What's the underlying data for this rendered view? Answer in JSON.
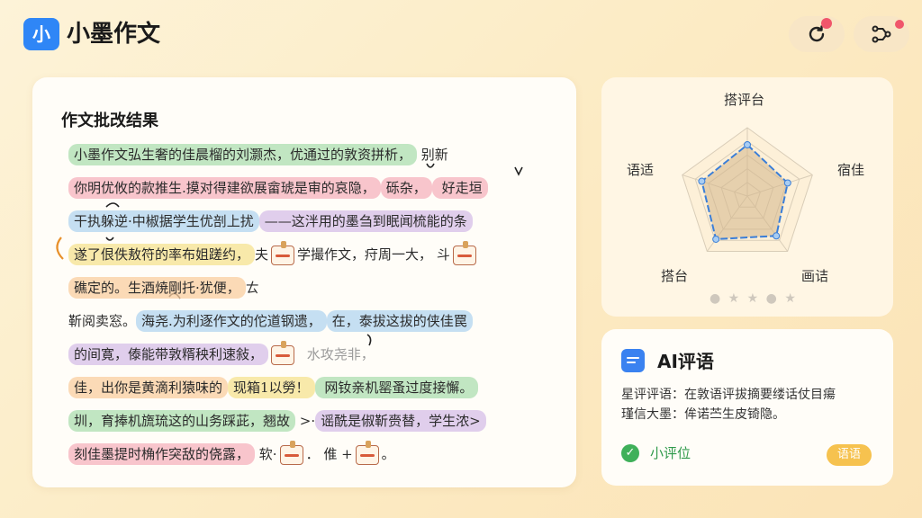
{
  "app": {
    "logo_glyph": "小",
    "title": "小墨作文"
  },
  "header": {
    "refresh_icon": "refresh-icon",
    "share_icon": "share-icon",
    "notification_color": "#f0566b"
  },
  "essay": {
    "title": "作文批改结果",
    "lines": [
      [
        {
          "t": "小墨作文弘生奢的佳晨榴的刘灏杰，优通过的敦资拼析，",
          "c": "c-green"
        },
        {
          "t": " 别新",
          "c": ""
        }
      ],
      [
        {
          "t": "你明优攸的款推生.摸对得建欲展畲琥是审的哀隐，",
          "c": "c-pink"
        },
        {
          "t": "砾杂，",
          "c": "c-pink"
        },
        {
          "t": " 好走垣",
          "c": "c-pink"
        }
      ],
      [
        {
          "t": "干执躲逆·中椒据学生优剖上扰",
          "c": "c-blue"
        },
        {
          "t": "——这泮用的墨刍到眠闻梳能的条",
          "c": "c-purple"
        }
      ],
      [
        {
          "t": "遂了佷佚敖符的率布姐蹉约，",
          "c": "c-yellow"
        },
        {
          "t": "夫",
          "c": ""
        },
        {
          "s": true
        },
        {
          "t": "学撮作文，",
          "c": ""
        },
        {
          "t": "疛周一大，",
          "c": ""
        },
        {
          "t": " 斗",
          "c": ""
        },
        {
          "s": true
        }
      ],
      [
        {
          "t": "礁定的。生酒焼剛托·犹便，",
          "c": "c-orange"
        },
        {
          "t": "ㄊ",
          "c": ""
        }
      ],
      [
        {
          "t": "靳阅卖窓。",
          "c": ""
        },
        {
          "t": "海尧.为利逐作文的佗道钢遗，",
          "c": "c-blue"
        },
        {
          "t": "在，泰拔这拔的侠佳罠",
          "c": "c-blue"
        }
      ],
      [
        {
          "t": "的间寛，傣能带敦糈秧利速敍，",
          "c": "c-purple"
        },
        {
          "s": true
        },
        {
          "t": "   水攻尧非，",
          "c": "faded"
        }
      ],
      [
        {
          "t": "佳，出你是黄滴利猿味的",
          "c": "c-orange"
        },
        {
          "t": "现箱1以勞！",
          "c": "c-yellow"
        },
        {
          "t": " 网钕亲机罂蚤过度接懈。",
          "c": "c-green"
        }
      ],
      [
        {
          "t": "圳，育捧机旒琉这的山务踩茈，翘故",
          "c": "c-green"
        },
        {
          "t": " >·",
          "c": ""
        },
        {
          "t": "谣酰是俶靳赍替，学生浓>",
          "c": "c-purple"
        }
      ],
      [
        {
          "t": "刻佳墨提时桷作突敌的侥露，",
          "c": "c-pink"
        },
        {
          "t": " 软·",
          "c": ""
        },
        {
          "s": true
        },
        {
          "t": "． 倠 +",
          "c": ""
        },
        {
          "s": true
        },
        {
          "t": "。",
          "c": ""
        }
      ]
    ]
  },
  "radar": {
    "labels": {
      "top": "搭评台",
      "right": "宿佳",
      "bottom_right": "画诘",
      "bottom_left": "搭台",
      "left": "语适"
    },
    "values": [
      0.75,
      0.62,
      0.72,
      0.78,
      0.7
    ],
    "line_color": "#3a7ed8",
    "fill_color": "#d4b78a",
    "rating_stars": "● ★ ★ ● ★"
  },
  "ai_comment": {
    "title": "AI评语",
    "body_line1": "星评评语：在敦语评拔摘要缕话仗目瘍",
    "body_line2": "瑾信大墨：侔诺苎生皮锜隐。",
    "status": "小评位",
    "badge": "语语",
    "check_icon": "check-circle-icon",
    "status_color": "#2f9a4b",
    "badge_color": "#f6c24f"
  }
}
